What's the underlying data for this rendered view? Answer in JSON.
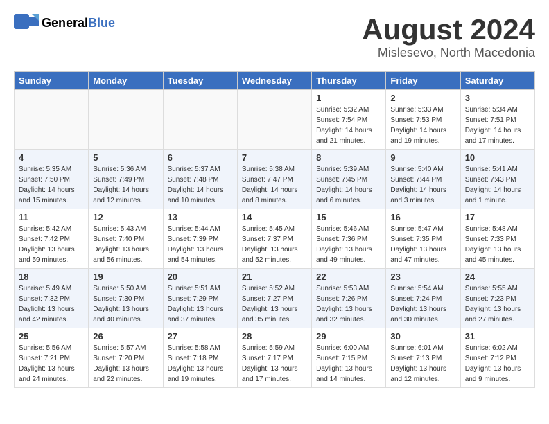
{
  "header": {
    "logo_general": "General",
    "logo_blue": "Blue",
    "month_year": "August 2024",
    "location": "Mislesevo, North Macedonia"
  },
  "calendar": {
    "days_of_week": [
      "Sunday",
      "Monday",
      "Tuesday",
      "Wednesday",
      "Thursday",
      "Friday",
      "Saturday"
    ],
    "weeks": [
      [
        {
          "day": "",
          "info": ""
        },
        {
          "day": "",
          "info": ""
        },
        {
          "day": "",
          "info": ""
        },
        {
          "day": "",
          "info": ""
        },
        {
          "day": "1",
          "info": "Sunrise: 5:32 AM\nSunset: 7:54 PM\nDaylight: 14 hours\nand 21 minutes."
        },
        {
          "day": "2",
          "info": "Sunrise: 5:33 AM\nSunset: 7:53 PM\nDaylight: 14 hours\nand 19 minutes."
        },
        {
          "day": "3",
          "info": "Sunrise: 5:34 AM\nSunset: 7:51 PM\nDaylight: 14 hours\nand 17 minutes."
        }
      ],
      [
        {
          "day": "4",
          "info": "Sunrise: 5:35 AM\nSunset: 7:50 PM\nDaylight: 14 hours\nand 15 minutes."
        },
        {
          "day": "5",
          "info": "Sunrise: 5:36 AM\nSunset: 7:49 PM\nDaylight: 14 hours\nand 12 minutes."
        },
        {
          "day": "6",
          "info": "Sunrise: 5:37 AM\nSunset: 7:48 PM\nDaylight: 14 hours\nand 10 minutes."
        },
        {
          "day": "7",
          "info": "Sunrise: 5:38 AM\nSunset: 7:47 PM\nDaylight: 14 hours\nand 8 minutes."
        },
        {
          "day": "8",
          "info": "Sunrise: 5:39 AM\nSunset: 7:45 PM\nDaylight: 14 hours\nand 6 minutes."
        },
        {
          "day": "9",
          "info": "Sunrise: 5:40 AM\nSunset: 7:44 PM\nDaylight: 14 hours\nand 3 minutes."
        },
        {
          "day": "10",
          "info": "Sunrise: 5:41 AM\nSunset: 7:43 PM\nDaylight: 14 hours\nand 1 minute."
        }
      ],
      [
        {
          "day": "11",
          "info": "Sunrise: 5:42 AM\nSunset: 7:42 PM\nDaylight: 13 hours\nand 59 minutes."
        },
        {
          "day": "12",
          "info": "Sunrise: 5:43 AM\nSunset: 7:40 PM\nDaylight: 13 hours\nand 56 minutes."
        },
        {
          "day": "13",
          "info": "Sunrise: 5:44 AM\nSunset: 7:39 PM\nDaylight: 13 hours\nand 54 minutes."
        },
        {
          "day": "14",
          "info": "Sunrise: 5:45 AM\nSunset: 7:37 PM\nDaylight: 13 hours\nand 52 minutes."
        },
        {
          "day": "15",
          "info": "Sunrise: 5:46 AM\nSunset: 7:36 PM\nDaylight: 13 hours\nand 49 minutes."
        },
        {
          "day": "16",
          "info": "Sunrise: 5:47 AM\nSunset: 7:35 PM\nDaylight: 13 hours\nand 47 minutes."
        },
        {
          "day": "17",
          "info": "Sunrise: 5:48 AM\nSunset: 7:33 PM\nDaylight: 13 hours\nand 45 minutes."
        }
      ],
      [
        {
          "day": "18",
          "info": "Sunrise: 5:49 AM\nSunset: 7:32 PM\nDaylight: 13 hours\nand 42 minutes."
        },
        {
          "day": "19",
          "info": "Sunrise: 5:50 AM\nSunset: 7:30 PM\nDaylight: 13 hours\nand 40 minutes."
        },
        {
          "day": "20",
          "info": "Sunrise: 5:51 AM\nSunset: 7:29 PM\nDaylight: 13 hours\nand 37 minutes."
        },
        {
          "day": "21",
          "info": "Sunrise: 5:52 AM\nSunset: 7:27 PM\nDaylight: 13 hours\nand 35 minutes."
        },
        {
          "day": "22",
          "info": "Sunrise: 5:53 AM\nSunset: 7:26 PM\nDaylight: 13 hours\nand 32 minutes."
        },
        {
          "day": "23",
          "info": "Sunrise: 5:54 AM\nSunset: 7:24 PM\nDaylight: 13 hours\nand 30 minutes."
        },
        {
          "day": "24",
          "info": "Sunrise: 5:55 AM\nSunset: 7:23 PM\nDaylight: 13 hours\nand 27 minutes."
        }
      ],
      [
        {
          "day": "25",
          "info": "Sunrise: 5:56 AM\nSunset: 7:21 PM\nDaylight: 13 hours\nand 24 minutes."
        },
        {
          "day": "26",
          "info": "Sunrise: 5:57 AM\nSunset: 7:20 PM\nDaylight: 13 hours\nand 22 minutes."
        },
        {
          "day": "27",
          "info": "Sunrise: 5:58 AM\nSunset: 7:18 PM\nDaylight: 13 hours\nand 19 minutes."
        },
        {
          "day": "28",
          "info": "Sunrise: 5:59 AM\nSunset: 7:17 PM\nDaylight: 13 hours\nand 17 minutes."
        },
        {
          "day": "29",
          "info": "Sunrise: 6:00 AM\nSunset: 7:15 PM\nDaylight: 13 hours\nand 14 minutes."
        },
        {
          "day": "30",
          "info": "Sunrise: 6:01 AM\nSunset: 7:13 PM\nDaylight: 13 hours\nand 12 minutes."
        },
        {
          "day": "31",
          "info": "Sunrise: 6:02 AM\nSunset: 7:12 PM\nDaylight: 13 hours\nand 9 minutes."
        }
      ]
    ]
  }
}
